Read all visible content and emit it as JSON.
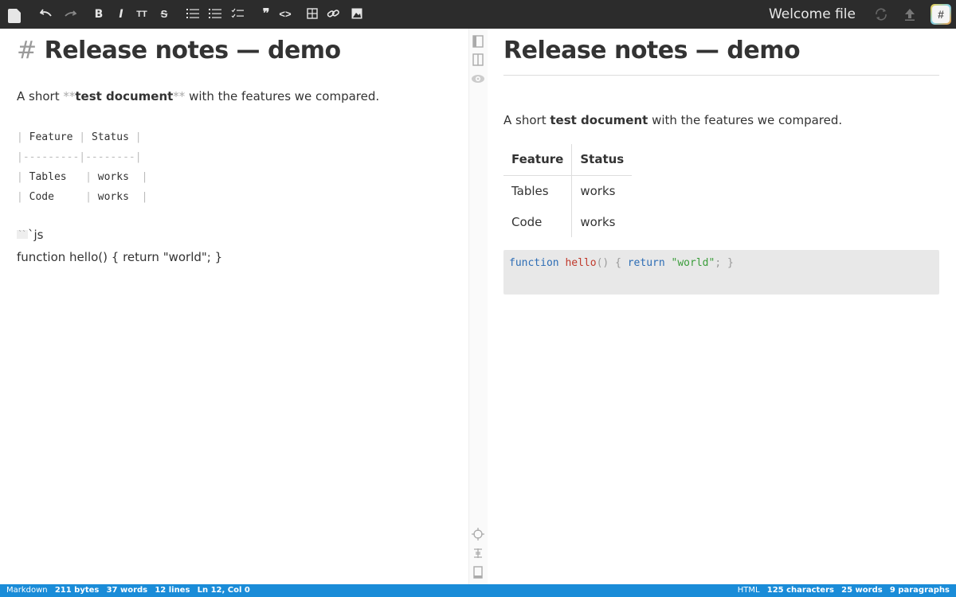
{
  "toolbar": {
    "bold": "B",
    "italic": "I",
    "heading": "TT",
    "strike": "S",
    "quote": "❞",
    "code": "<>",
    "file_title": "Welcome file",
    "hash_badge": "#"
  },
  "editor": {
    "heading_marker": "#",
    "heading_text": "Release notes — demo",
    "para_prefix": "A short",
    "para_bold_marker_open": "**",
    "para_bold_text": "test document",
    "para_bold_marker_close": "**",
    "para_suffix": "with the features we compared.",
    "table_header": [
      "Feature",
      "Status"
    ],
    "table_sep": [
      "---------",
      "--------"
    ],
    "table_rows": [
      [
        "Tables",
        "works"
      ],
      [
        "Code",
        "works"
      ]
    ],
    "fence_marker": "``",
    "fence_lang": "`js",
    "code_line": "function hello() { return \"world\"; }"
  },
  "preview": {
    "heading": "Release notes — demo",
    "para_prefix": "A short",
    "para_bold": "test document",
    "para_suffix": "with the features we compared.",
    "table_header": [
      "Feature",
      "Status"
    ],
    "table_rows": [
      [
        "Tables",
        "works"
      ],
      [
        "Code",
        "works"
      ]
    ],
    "code_tokens": {
      "kw1": "function",
      "fn": "hello",
      "p1": "()",
      "p2": "{",
      "kw2": "return",
      "str": "\"world\"",
      "p3": ";",
      "p4": "}"
    }
  },
  "status_left": {
    "mode": "Markdown",
    "bytes": "211 bytes",
    "words": "37 words",
    "lines": "12 lines",
    "cursor": "Ln 12, Col 0"
  },
  "status_right": {
    "mode": "HTML",
    "characters": "125 characters",
    "words": "25 words",
    "paragraphs": "9 paragraphs"
  },
  "colors": {
    "toolbar_bg": "#2c2c2c",
    "status_bg": "#1a8cd8",
    "code_keyword": "#2d6db5",
    "code_function": "#c0392b",
    "code_string": "#3a9d3a"
  }
}
